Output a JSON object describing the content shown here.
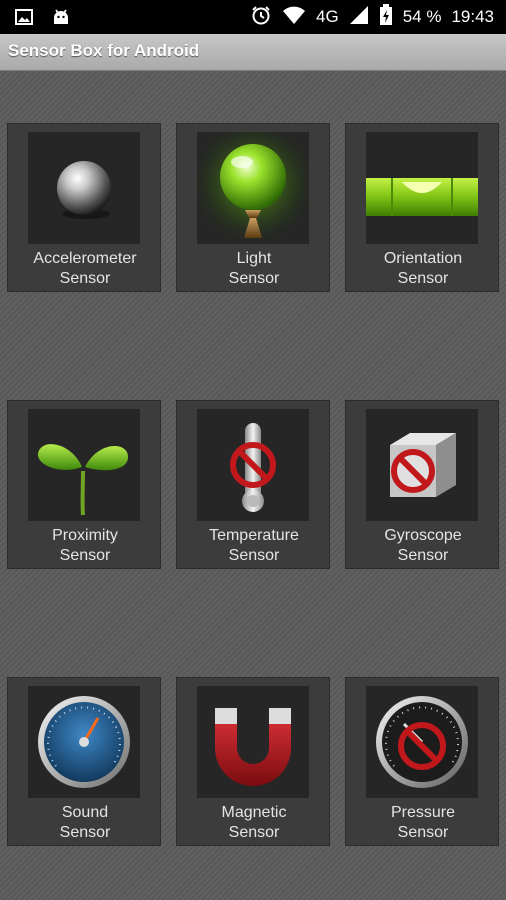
{
  "status_bar": {
    "network": "4G",
    "battery": "54 %",
    "time": "19:43",
    "icons": [
      "gallery-icon",
      "android-icon",
      "alarm-icon",
      "wifi-icon",
      "signal-icon",
      "battery-icon"
    ]
  },
  "app_bar": {
    "title": "Sensor Box for Android"
  },
  "sensors": [
    {
      "line1": "Accelerometer",
      "line2": "Sensor",
      "icon": "metal-ball-icon",
      "available": true
    },
    {
      "line1": "Light",
      "line2": "Sensor",
      "icon": "light-bulb-icon",
      "available": true
    },
    {
      "line1": "Orientation",
      "line2": "Sensor",
      "icon": "spirit-level-icon",
      "available": true
    },
    {
      "line1": "Proximity",
      "line2": "Sensor",
      "icon": "sprout-icon",
      "available": true
    },
    {
      "line1": "Temperature",
      "line2": "Sensor",
      "icon": "thermometer-icon",
      "available": false
    },
    {
      "line1": "Gyroscope",
      "line2": "Sensor",
      "icon": "cube-icon",
      "available": false
    },
    {
      "line1": "Sound",
      "line2": "Sensor",
      "icon": "sound-gauge-icon",
      "available": true
    },
    {
      "line1": "Magnetic",
      "line2": "Sensor",
      "icon": "magnet-icon",
      "available": true
    },
    {
      "line1": "Pressure",
      "line2": "Sensor",
      "icon": "pressure-gauge-icon",
      "available": false
    }
  ],
  "colors": {
    "accent_green": "#8ad11c",
    "unavailable_red": "#c0181b",
    "gauge_blue": "#1e5e93"
  }
}
